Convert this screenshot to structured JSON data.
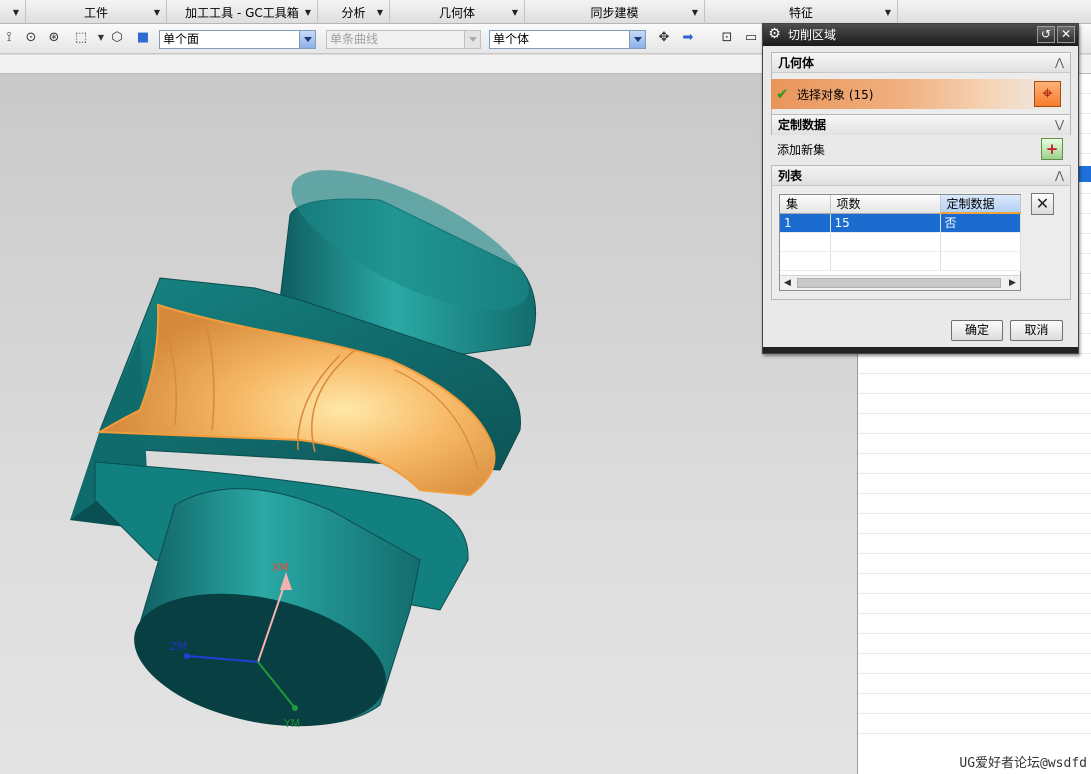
{
  "menu_groups": [
    {
      "label": ""
    },
    {
      "label": "工件"
    },
    {
      "label": "加工工具 - GC工具箱"
    },
    {
      "label": "分析"
    },
    {
      "label": "几何体"
    },
    {
      "label": "同步建模"
    },
    {
      "label": "特征"
    }
  ],
  "toolbar": {
    "face_filter": "单个面",
    "curve_filter": "单条曲线",
    "body_filter": "单个体"
  },
  "icons": [
    "snap-point-icon",
    "select-circle-icon",
    "select-point-icon",
    "box-select-icon",
    "body-select-icon",
    "solid-cube-icon",
    "pin-icon",
    "arrow-right-icon",
    "zoom-icon"
  ],
  "dialog": {
    "title": "切削区域",
    "geometry_section": "几何体",
    "select_object": "选择对象 (15)",
    "custom_data_section": "定制数据",
    "add_new_set": "添加新集",
    "list_section": "列表",
    "table": {
      "headers": [
        "集",
        "项数",
        "定制数据"
      ],
      "rows": [
        [
          "1",
          "15",
          "否"
        ]
      ]
    },
    "ok_label": "确定",
    "cancel_label": "取消"
  },
  "axes": {
    "xm": "XM",
    "ym": "YM",
    "zm": "ZM"
  },
  "watermark": "UG爱好者论坛@wsdfd",
  "colors": {
    "part_teal": "#1e8c8c",
    "cut_region_orange": "#f2a75a",
    "selection_blue": "#1c6ccf"
  }
}
